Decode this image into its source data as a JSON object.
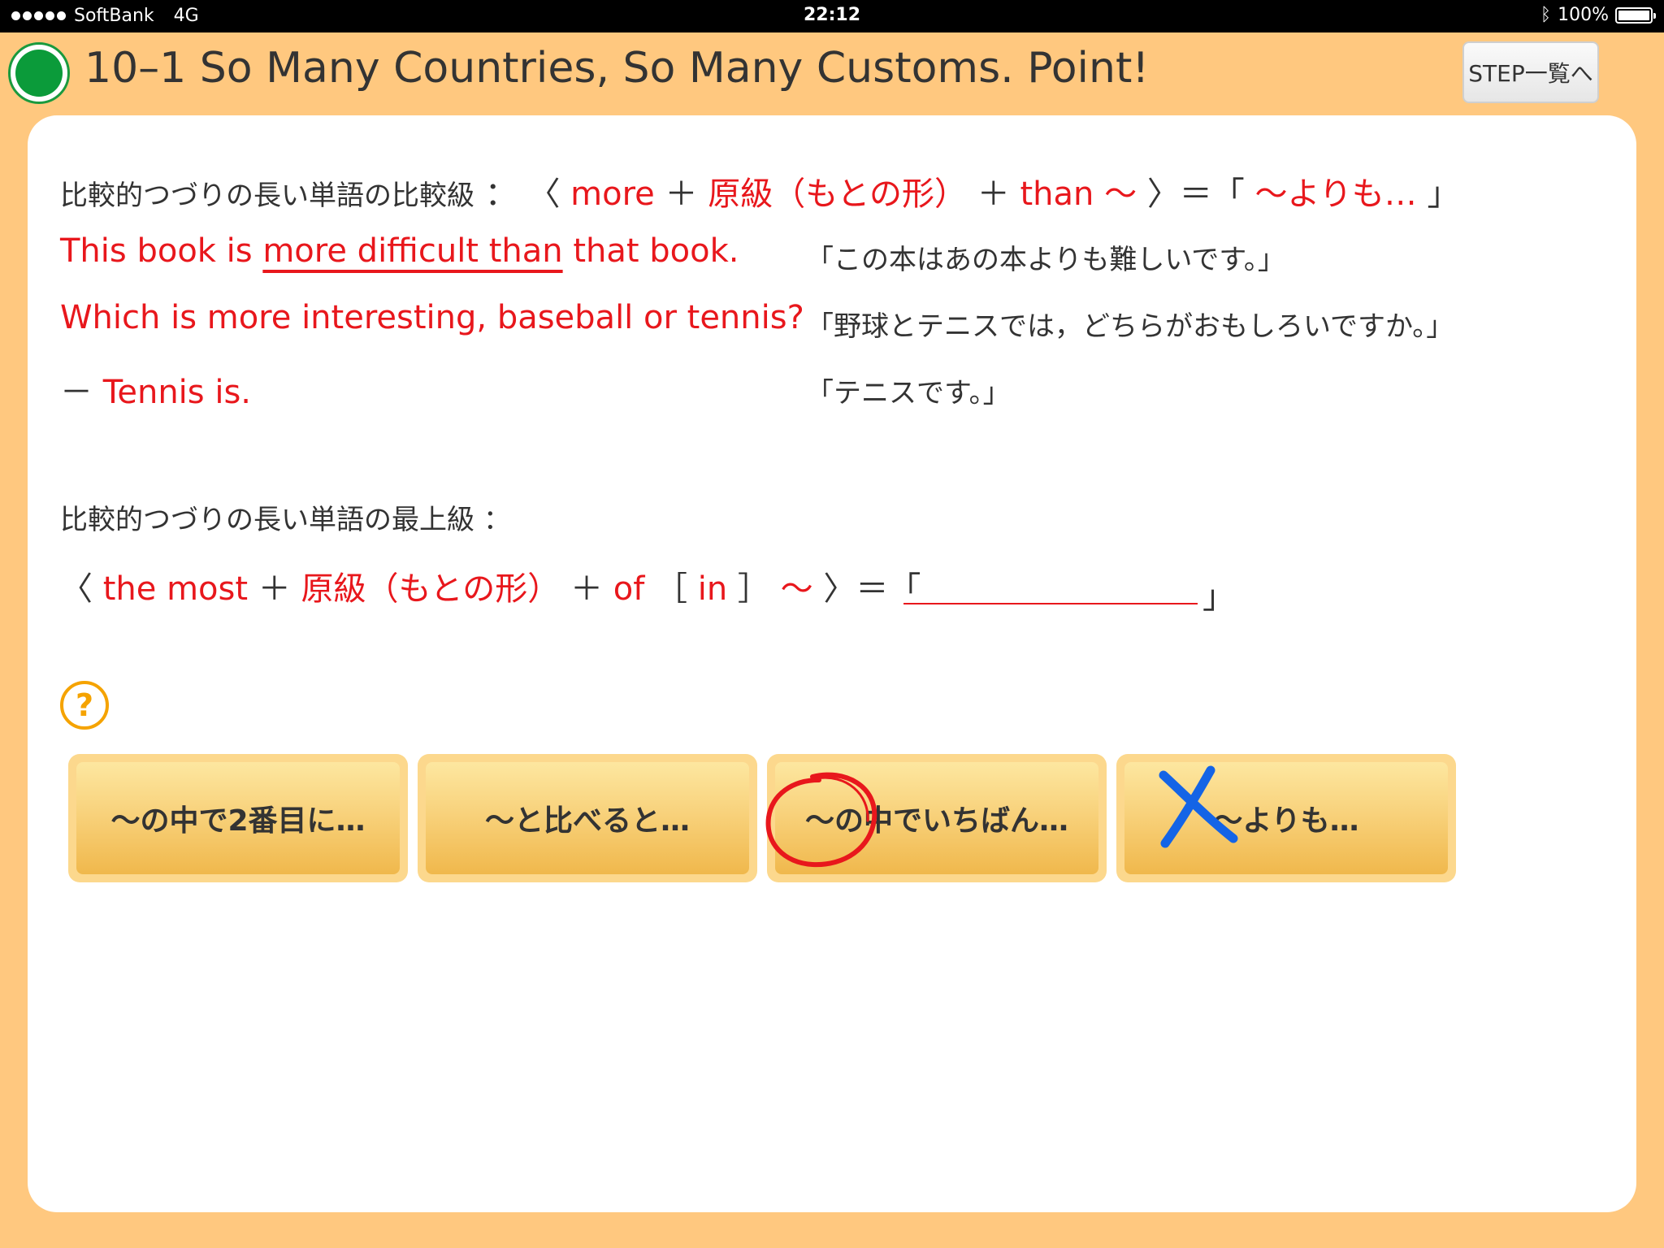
{
  "status_bar": {
    "carrier": "SoftBank",
    "network": "4G",
    "time": "22:12",
    "battery_text": "100%",
    "battery_level": 1.0,
    "icons": [
      "signal-dots-icon",
      "bluetooth-icon",
      "battery-icon"
    ]
  },
  "header": {
    "title": "10–1 So Many Countries, So Many Customs. Point!",
    "step_button": "STEP一覧へ",
    "status_icon": "green-circle-icon"
  },
  "lesson": {
    "comparative": {
      "rule_label": "比較的つづりの長い単語の比較級",
      "colon": "：",
      "open_paren": "〈",
      "more": "more",
      "plus1": "＋",
      "base_form": "原級（もとの形）",
      "plus2": "＋",
      "than": "than ～",
      "close_paren": "〉＝「",
      "meaning": "～よりも…",
      "close_quote": "」"
    },
    "examples": [
      {
        "en_pre": "This book is",
        "en_underlined": "more difficult than",
        "en_post": "that book.",
        "ja": "「この本はあの本よりも難しいです。」"
      },
      {
        "en": "Which is more interesting, baseball or tennis?",
        "ja": "「野球とテニスでは，どちらがおもしろいですか。」"
      },
      {
        "dash": "－",
        "en": "Tennis is.",
        "ja": "「テニスです。」"
      }
    ],
    "superlative": {
      "rule_label": "比較的つづりの長い単語の最上級",
      "colon": "：",
      "open_paren": "〈",
      "the_most": "the most",
      "plus1": "＋",
      "base_form": "原級（もとの形）",
      "plus2": "＋",
      "of": "of",
      "bracket_open": "［",
      "in": "in",
      "bracket_close": "］",
      "tilde": "～",
      "close_paren": "〉＝「",
      "close_quote": "」"
    }
  },
  "help_icon": "?",
  "choices": [
    {
      "label": "～の中で2番目に…",
      "mark": null
    },
    {
      "label": "～と比べると…",
      "mark": null
    },
    {
      "label": "～の中でいちばん…",
      "mark": "circle"
    },
    {
      "label": "～よりも…",
      "mark": "cross"
    }
  ],
  "colors": {
    "background": "#ffc87f",
    "accent_red": "#e8171c",
    "button_orange": "#f0b84c",
    "correct_mark": "#e8171c",
    "wrong_mark": "#1464e6",
    "status_green": "#0b9b3a"
  }
}
